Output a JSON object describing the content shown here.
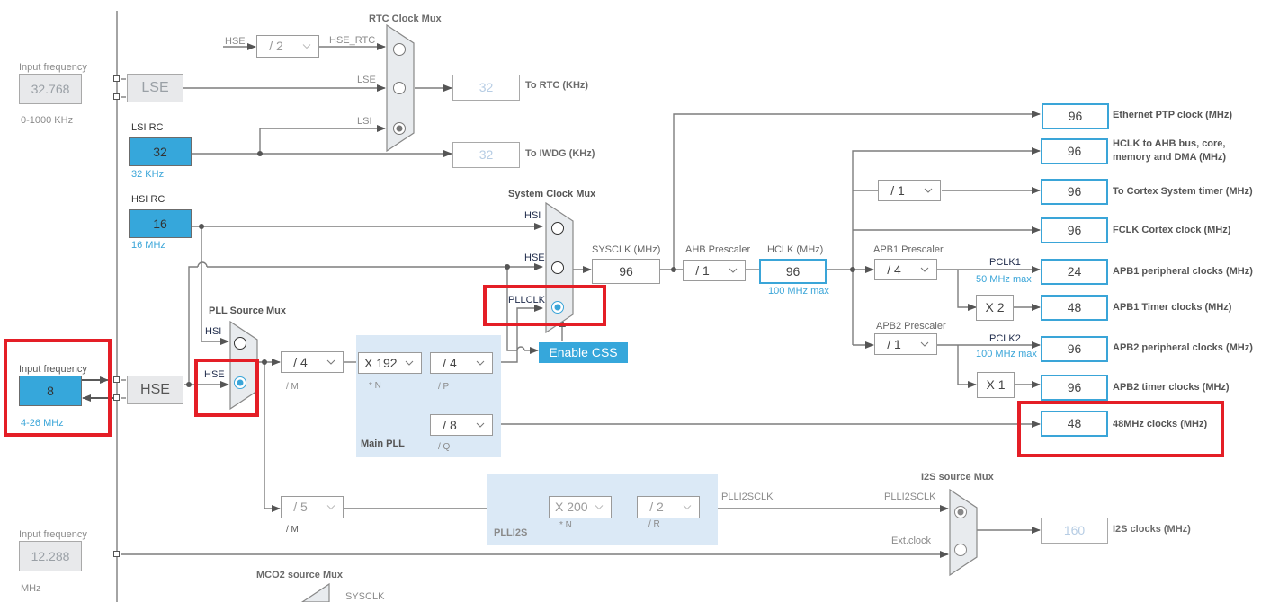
{
  "diagram": {
    "lse_input": {
      "label": "Input frequency",
      "value": "32.768",
      "range": "0-1000 KHz"
    },
    "hse_input": {
      "label": "Input frequency",
      "value": "8",
      "range": "4-26 MHz"
    },
    "i2s_ext_input": {
      "label": "Input frequency",
      "value": "12.288",
      "unit": "MHz"
    },
    "lse_block": "LSE",
    "hse_block": "HSE",
    "lsi_rc": {
      "title": "LSI RC",
      "value": "32",
      "note": "32 KHz"
    },
    "hsi_rc": {
      "title": "HSI RC",
      "value": "16",
      "note": "16 MHz"
    },
    "rtc_mux": {
      "title": "RTC Clock Mux",
      "hse_in_label": "HSE",
      "divider": "/ 2",
      "inputs": [
        "HSE_RTC",
        "LSE",
        "LSI"
      ],
      "selected_index": 2,
      "to_rtc": {
        "value": "32",
        "label": "To RTC (KHz)"
      },
      "to_iwdg": {
        "value": "32",
        "label": "To IWDG (KHz)"
      }
    },
    "pll_source_mux": {
      "title": "PLL Source Mux",
      "inputs": [
        "HSI",
        "HSE"
      ],
      "selected_index": 1
    },
    "main_pll": {
      "title": "Main PLL",
      "m": {
        "value": "/ 4",
        "label": "/ M"
      },
      "n": {
        "value": "X 192",
        "label": "* N"
      },
      "p": {
        "value": "/ 4",
        "label": "/ P"
      },
      "q": {
        "value": "/ 8",
        "label": "/ Q"
      }
    },
    "system_clock_mux": {
      "title": "System Clock Mux",
      "inputs": [
        "HSI",
        "HSE",
        "PLLCLK"
      ],
      "selected_index": 2
    },
    "enable_css": "Enable CSS",
    "sysclk": {
      "label": "SYSCLK (MHz)",
      "value": "96"
    },
    "ahb_prescaler": {
      "label": "AHB Prescaler",
      "value": "/ 1"
    },
    "hclk": {
      "label": "HCLK (MHz)",
      "value": "96",
      "max": "100 MHz max"
    },
    "cortex_timer_div": "/ 1",
    "apb1": {
      "label": "APB1 Prescaler",
      "value": "/ 4",
      "pclk": "PCLK1",
      "max": "50 MHz max",
      "timer_mult": "X 2"
    },
    "apb2": {
      "label": "APB2 Prescaler",
      "value": "/ 1",
      "pclk": "PCLK2",
      "max": "100 MHz max",
      "timer_mult": "X 1"
    },
    "outputs": [
      {
        "value": "96",
        "label": "Ethernet PTP clock (MHz)"
      },
      {
        "value": "96",
        "label": "HCLK to AHB bus, core,",
        "label2": "memory and DMA (MHz)"
      },
      {
        "value": "96",
        "label": "To Cortex System timer (MHz)"
      },
      {
        "value": "96",
        "label": "FCLK Cortex clock (MHz)"
      },
      {
        "value": "24",
        "label": "APB1 peripheral clocks (MHz)"
      },
      {
        "value": "48",
        "label": "APB1 Timer clocks (MHz)"
      },
      {
        "value": "96",
        "label": "APB2 peripheral clocks (MHz)"
      },
      {
        "value": "96",
        "label": "APB2 timer clocks (MHz)"
      },
      {
        "value": "48",
        "label": "48MHz clocks (MHz)"
      }
    ],
    "plli2s": {
      "title": "PLLI2S",
      "m": {
        "value": "/ 5",
        "label": "/ M"
      },
      "n": {
        "value": "X 200",
        "label": "* N"
      },
      "r": {
        "value": "/ 2",
        "label": "/ R"
      },
      "out_label": "PLLI2SCLK"
    },
    "i2s_mux": {
      "title": "I2S source Mux",
      "inputs": [
        "PLLI2SCLK",
        "Ext.clock"
      ],
      "selected_index": 0,
      "output": {
        "value": "160",
        "label": "I2S clocks (MHz)"
      }
    },
    "mco2_mux": {
      "title": "MCO2 source Mux",
      "first_input": "SYSCLK"
    },
    "highlight_color": "#e41e26",
    "accent_color": "#36a7db"
  }
}
